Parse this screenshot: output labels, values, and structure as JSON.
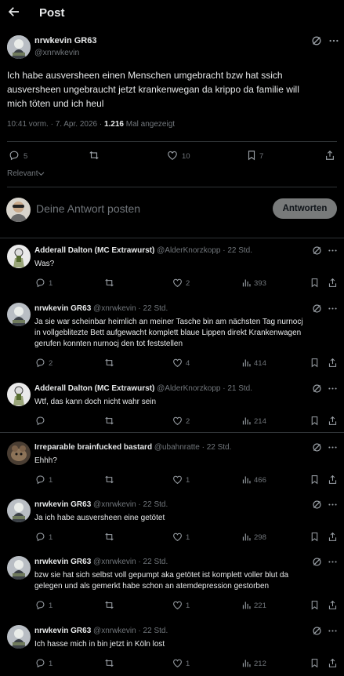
{
  "header": {
    "title": "Post"
  },
  "post": {
    "author_name": "nrwkevin GR63",
    "author_handle": "@xnrwkevin",
    "text_line1": "Ich habe ausversheen einen Menschen umgebracht bzw hat ssich",
    "text_line2": "ausversheen ungebraucht jetzt krankenwegan da krippo da familie will",
    "text_line3": "mich töten und ich heul",
    "time": "10:41 vorm. · 7. Apr. 2026 ·",
    "views_count": "1.216",
    "views_label": "Mal angezeigt",
    "replies": "5",
    "likes": "10",
    "bookmarks": "7",
    "sort_label": "Relevant"
  },
  "composer": {
    "placeholder": "Deine Antwort posten",
    "button_label": "Antworten"
  },
  "replies": [
    {
      "name": "Adderall Dalton (MC Extrawurst)",
      "handle": "@AlderKnorzkopp · 22 Std.",
      "lines": [
        "Was?"
      ],
      "replies": "1",
      "likes": "2",
      "views": "393"
    },
    {
      "name": "nrwkevin GR63",
      "handle": "@xnrwkevin · 22 Std.",
      "lines": [
        "Ja sie war scheinbar heimlich an meiner Tasche bin am nächsten Tag nurnocj",
        "in vollgeblitezte Bett aufgewacht komplett blaue Lippen direkt Krankenwagen",
        "gerufen konnten nurnocj den tot feststellen"
      ],
      "replies": "2",
      "likes": "4",
      "views": "414"
    },
    {
      "name": "Adderall Dalton (MC Extrawurst)",
      "handle": "@AlderKnorzkopp · 21 Std.",
      "lines": [
        "Wtf, das kann doch nicht wahr sein"
      ],
      "replies": "",
      "likes": "2",
      "views": "214"
    },
    {
      "name": "Irreparable brainfucked bastard",
      "handle": "@ubahnratte · 22 Std.",
      "lines": [
        "Ehhh?"
      ],
      "replies": "1",
      "likes": "1",
      "views": "466"
    },
    {
      "name": "nrwkevin GR63",
      "handle": "@xnrwkevin · 22 Std.",
      "lines": [
        "Ja ich habe ausversheen eine getötet"
      ],
      "replies": "1",
      "likes": "1",
      "views": "298"
    },
    {
      "name": "nrwkevin GR63",
      "handle": "@xnrwkevin · 22 Std.",
      "lines": [
        "bzw sie hat sich selbst voll gepumpt aka getötet ist komplett voller blut da",
        "gelegen und als gemerkt habe schon an atemdepression gestorben"
      ],
      "replies": "1",
      "likes": "1",
      "views": "221"
    },
    {
      "name": "nrwkevin GR63",
      "handle": "@xnrwkevin · 22 Std.",
      "lines": [
        "Ich hasse mich in bin jetzt in Köln lost"
      ],
      "replies": "1",
      "likes": "1",
      "views": "212"
    }
  ],
  "colors": {
    "background": "#000000",
    "text": "#e7e9ea",
    "muted": "#71767b",
    "divider": "#2f3336",
    "button_bg": "#787a7a"
  }
}
